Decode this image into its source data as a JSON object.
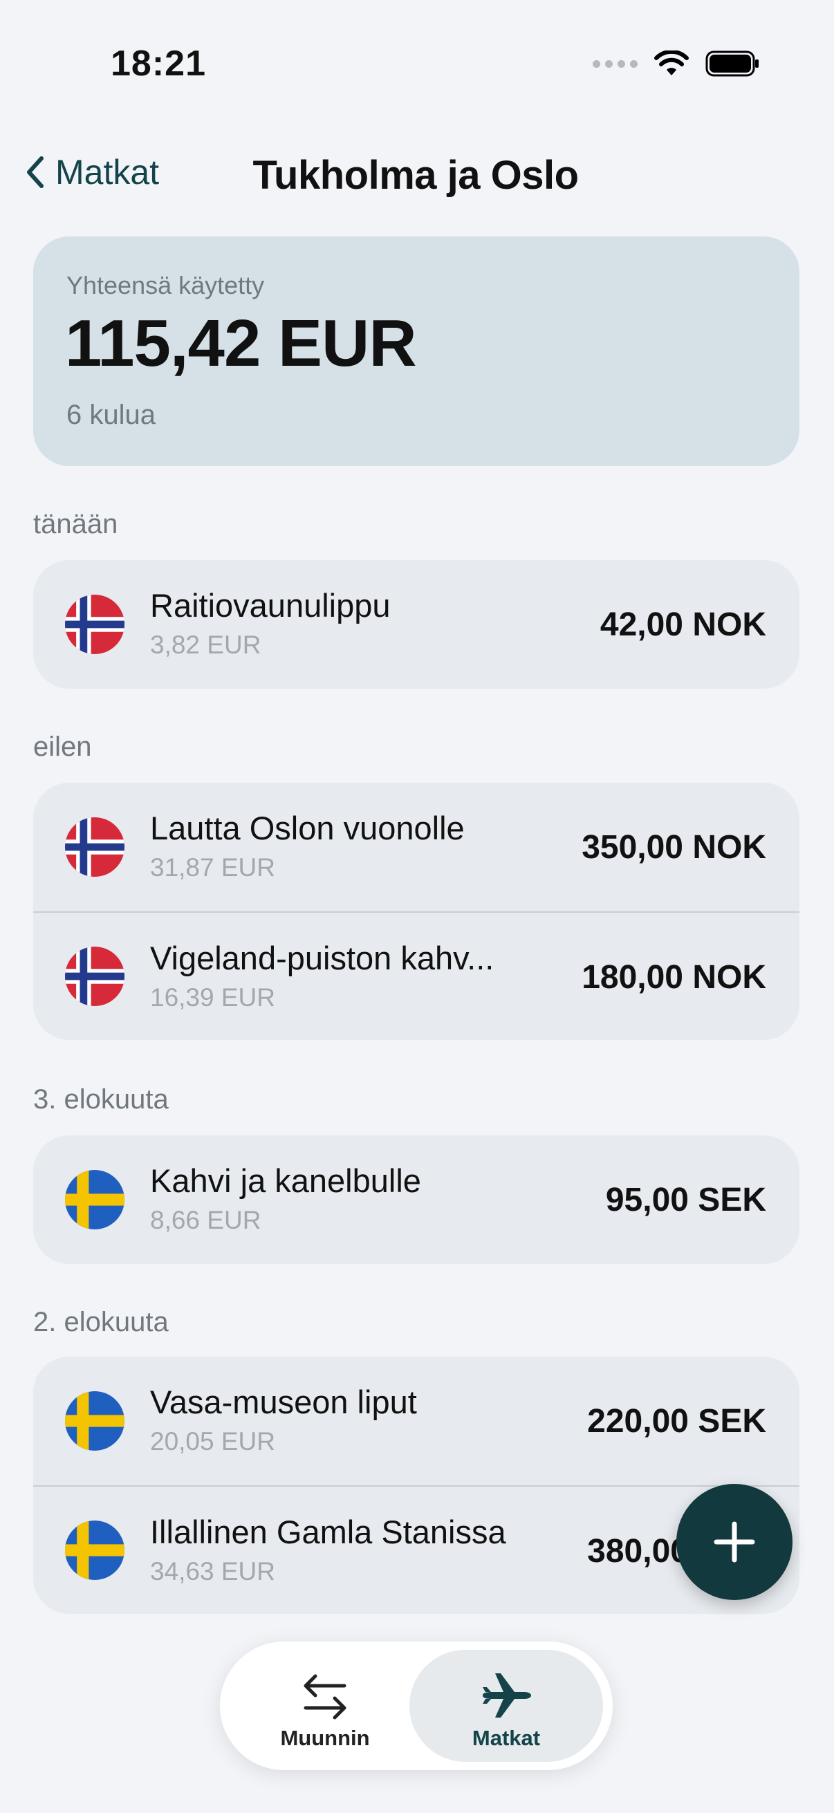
{
  "status_bar": {
    "time": "18:21"
  },
  "nav": {
    "back_label": "Matkat",
    "title": "Tukholma ja Oslo"
  },
  "summary": {
    "label": "Yhteensä käytetty",
    "total": "115,42 EUR",
    "count": "6 kulua"
  },
  "sections": [
    {
      "label": "tänään",
      "items": [
        {
          "name": "Raitiovaunulippu",
          "converted": "3,82 EUR",
          "amount": "42,00 NOK",
          "flag": "norway-flag-icon"
        }
      ]
    },
    {
      "label": "eilen",
      "items": [
        {
          "name": "Lautta Oslon vuonolle",
          "converted": "31,87 EUR",
          "amount": "350,00 NOK",
          "flag": "norway-flag-icon"
        },
        {
          "name": "Vigeland-puiston kahv...",
          "converted": "16,39 EUR",
          "amount": "180,00 NOK",
          "flag": "norway-flag-icon"
        }
      ]
    },
    {
      "label": "3. elokuuta",
      "items": [
        {
          "name": "Kahvi ja kanelbulle",
          "converted": "8,66 EUR",
          "amount": "95,00 SEK",
          "flag": "sweden-flag-icon"
        }
      ]
    },
    {
      "label": "2. elokuuta",
      "items": [
        {
          "name": "Vasa-museon liput",
          "converted": "20,05 EUR",
          "amount": "220,00 SEK",
          "flag": "sweden-flag-icon"
        },
        {
          "name": "Illallinen Gamla Stanissa",
          "converted": "34,63 EUR",
          "amount": "380,00 SEK",
          "flag": "sweden-flag-icon"
        }
      ]
    }
  ],
  "tabbar": {
    "tabs": [
      {
        "label": "Muunnin",
        "icon": "swap-arrows-icon",
        "selected": false
      },
      {
        "label": "Matkat",
        "icon": "airplane-icon",
        "selected": true
      }
    ]
  },
  "colors": {
    "accent": "#12393d",
    "summary_bg": "#d5e1e7",
    "card_bg": "#e7eaee",
    "page_bg": "#f2f4f8"
  }
}
